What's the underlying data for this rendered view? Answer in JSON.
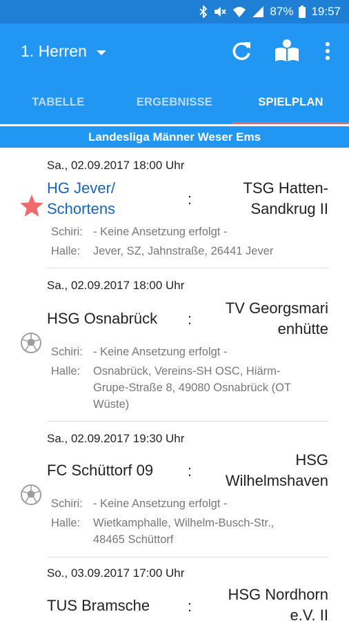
{
  "status_bar": {
    "battery": "87%",
    "time": "19:57"
  },
  "app_bar": {
    "title": "1. Herren",
    "actions": [
      "refresh-icon",
      "book-icon",
      "more-vert-icon"
    ]
  },
  "tabs": [
    {
      "label": "TABELLE",
      "active": false
    },
    {
      "label": "ERGEBNISSE",
      "active": false
    },
    {
      "label": "SPIELPLAN",
      "active": true
    }
  ],
  "league": "Landesliga Männer Weser Ems",
  "matches": [
    {
      "date": "Sa., 02.09.2017 18:00 Uhr",
      "home_line1": "HG Jever/",
      "home_line2": "Schortens",
      "away_line1": "TSG Hatten-",
      "away_line2": "Sandkrug II",
      "schiri_label": "Schiri:",
      "schiri": "- Keine Ansetzung erfolgt -",
      "halle_label": "Halle:",
      "halle": "Jever, SZ, Jahnstraße, 26441 Jever",
      "icon": "star-icon"
    },
    {
      "date": "Sa., 02.09.2017 18:00 Uhr",
      "home_line1": "HSG Osnabrück",
      "away_line1": "TV Georgsmari",
      "away_line2": "enhütte",
      "schiri_label": "Schiri:",
      "schiri": "- Keine Ansetzung erfolgt -",
      "halle_label": "Halle:",
      "halle_line1": "Osnabrück, Vereins-SH OSC, Hiärm-",
      "halle_line2": "Grupe-Straße 8, 49080 Osnabrück (OT",
      "halle_line3": "Wüste)",
      "icon": "handball-icon"
    },
    {
      "date": "Sa., 02.09.2017 19:30 Uhr",
      "home_line1": "FC Schüttorf 09",
      "away_line1": "HSG",
      "away_line2": "Wilhelmshaven",
      "schiri_label": "Schiri:",
      "schiri": "- Keine Ansetzung erfolgt -",
      "halle_label": "Halle:",
      "halle_line1": "Wietkamphalle, Wilhelm-Busch-Str.,",
      "halle_line2": "48465 Schüttorf",
      "icon": "handball-icon"
    },
    {
      "date": "So., 03.09.2017 17:00 Uhr",
      "home_line1": "TUS Bramsche",
      "away_line1": "HSG Nordhorn",
      "away_line2": "e.V. II"
    }
  ],
  "separator": ":",
  "colors": {
    "primary": "#2196f3",
    "status_bar": "#1f7fd4",
    "tab_indicator": "#e8646f",
    "favorite_star": "#ef6a6a",
    "favorite_text": "#1565c0"
  }
}
